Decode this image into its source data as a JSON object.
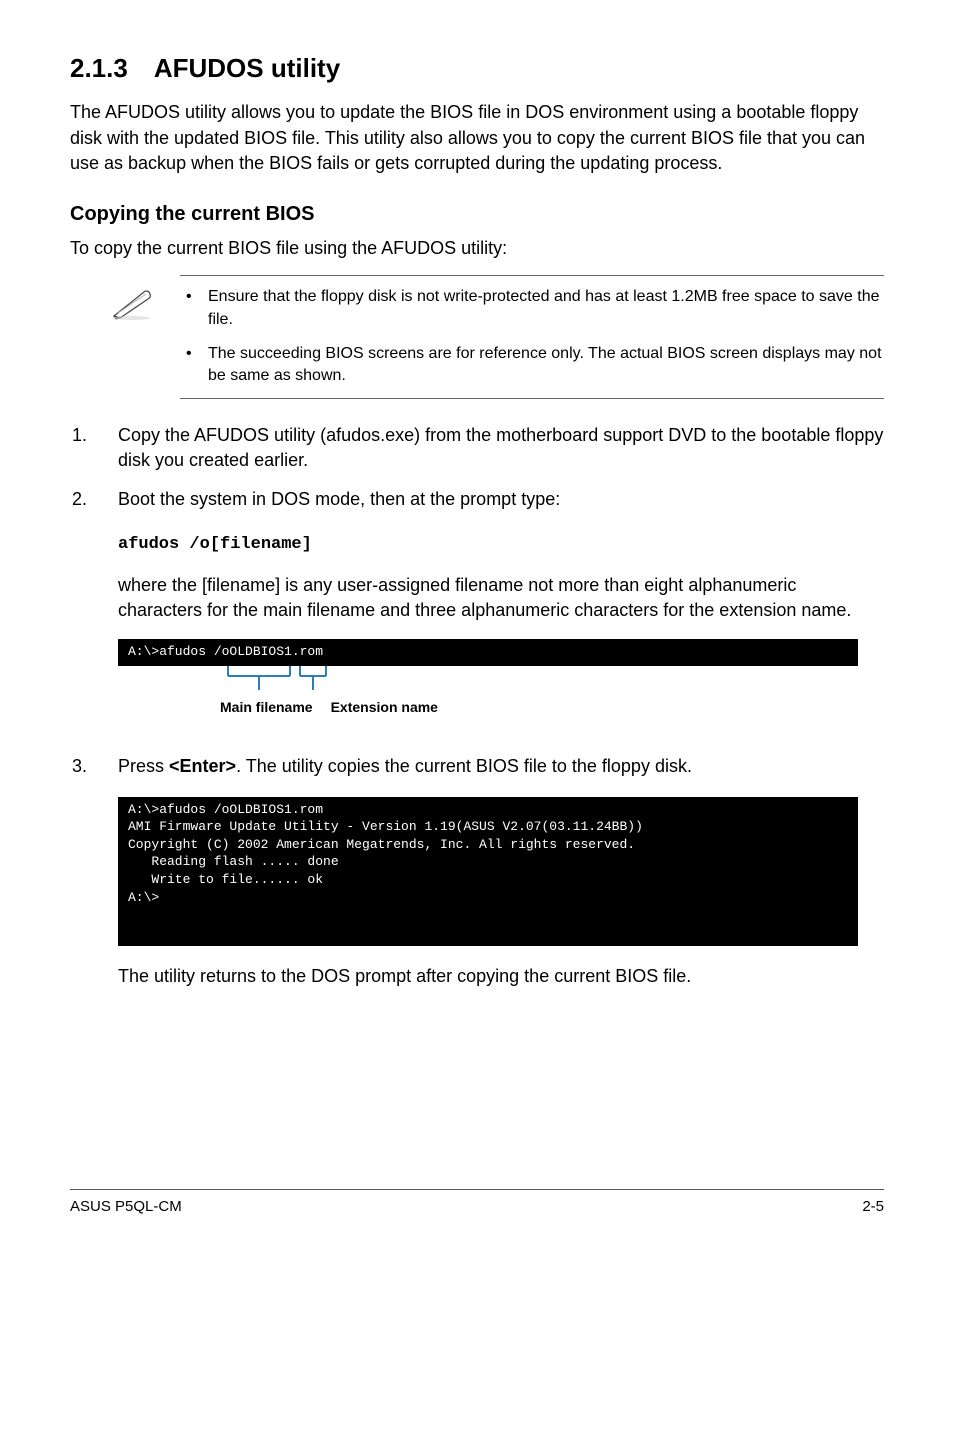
{
  "heading": "2.1.3 AFUDOS utility",
  "intro": "The AFUDOS utility allows you to update the BIOS file in DOS environment using a bootable floppy disk with the updated BIOS file. This utility also allows you to copy the current BIOS file that you can use as backup when the BIOS fails or gets corrupted during the updating process.",
  "subheading": "Copying the current BIOS",
  "subintro": "To copy the current BIOS file using the AFUDOS utility:",
  "notes": [
    "Ensure that the floppy disk is not write-protected and has at least 1.2MB free space to save the file.",
    "The succeeding BIOS screens are for reference only. The actual BIOS screen displays may not be same as shown."
  ],
  "steps12": [
    "Copy the AFUDOS utility (afudos.exe) from the motherboard support DVD to the bootable floppy disk you created earlier.",
    "Boot the system in DOS mode, then at the prompt type:"
  ],
  "cmd": "afudos /o[filename]",
  "cmd_desc": "where the [filename] is any user-assigned filename not more than eight alphanumeric characters for the main filename and three alphanumeric characters for the extension name.",
  "term1": "A:\\>afudos /oOLDBIOS1.rom",
  "label_main": "Main filename",
  "label_ext": "Extension name",
  "step3_prefix": "Press ",
  "step3_key": "<Enter>",
  "step3_suffix": ". The utility copies the current BIOS file to the floppy disk.",
  "term2": "A:\\>afudos /oOLDBIOS1.rom\nAMI Firmware Update Utility - Version 1.19(ASUS V2.07(03.11.24BB))\nCopyright (C) 2002 American Megatrends, Inc. All rights reserved.\n   Reading flash ..... done\n   Write to file...... ok\nA:\\>",
  "after_term2": "The utility returns to the DOS prompt after copying the current BIOS file.",
  "footer_left": "ASUS P5QL-CM",
  "footer_right": "2-5"
}
